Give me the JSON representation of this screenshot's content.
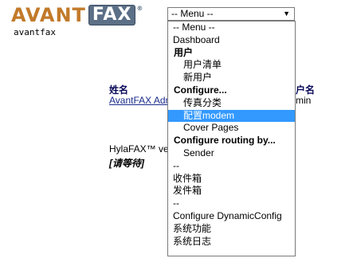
{
  "logo": {
    "avant": "AVANT",
    "fax": "FAX",
    "tm": "®"
  },
  "user": {
    "login": "avantfax"
  },
  "background": {
    "name_header": "姓名",
    "name_link": "AvantFAX Admin",
    "user_header": "户名",
    "user_value": "min",
    "hylafax": "HylaFAX™ ve",
    "wait": "[请等待]"
  },
  "menu": {
    "selected_value": "-- Menu --",
    "options": [
      {
        "label": "-- Menu --",
        "type": "option"
      },
      {
        "label": "Dashboard",
        "type": "option"
      },
      {
        "label": "用户",
        "type": "group"
      },
      {
        "label": "用户清单",
        "type": "indent"
      },
      {
        "label": "新用户",
        "type": "indent"
      },
      {
        "label": "Configure...",
        "type": "group"
      },
      {
        "label": "传真分类",
        "type": "indent"
      },
      {
        "label": "配置modem",
        "type": "indent",
        "highlighted": true
      },
      {
        "label": "Cover Pages",
        "type": "indent"
      },
      {
        "label": "Configure routing by...",
        "type": "group"
      },
      {
        "label": "Sender",
        "type": "indent"
      },
      {
        "label": "--",
        "type": "option"
      },
      {
        "label": "收件箱",
        "type": "option"
      },
      {
        "label": "发件箱",
        "type": "option"
      },
      {
        "label": "--",
        "type": "option"
      },
      {
        "label": "Configure DynamicConfig",
        "type": "option"
      },
      {
        "label": "系统功能",
        "type": "option"
      },
      {
        "label": "系统日志",
        "type": "option"
      }
    ]
  },
  "colors": {
    "highlight": "#3399ff",
    "logo_orange": "#c27a2a",
    "logo_blue": "#5b6f86",
    "header_text": "#0a0a5a"
  }
}
